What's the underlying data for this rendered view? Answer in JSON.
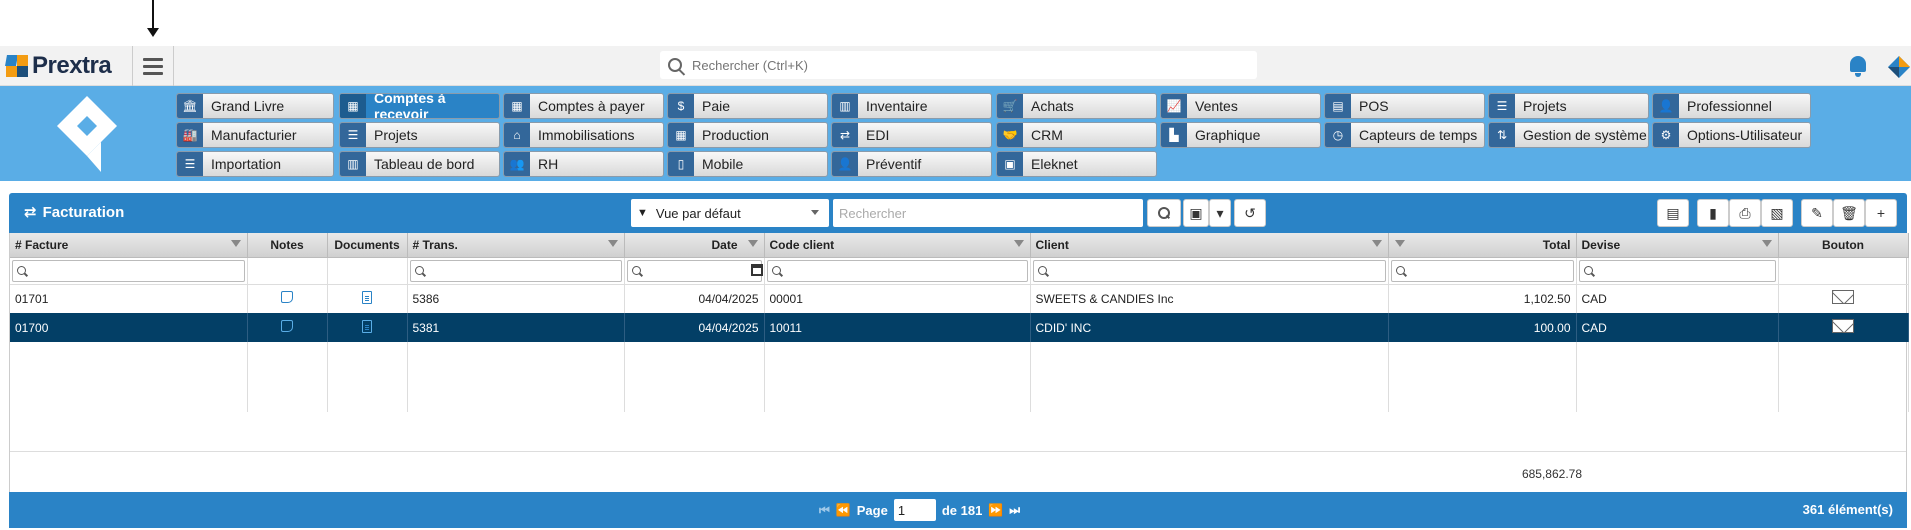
{
  "brand": {
    "name": "Prextra"
  },
  "global_search": {
    "placeholder": "Rechercher (Ctrl+K)"
  },
  "modules": [
    {
      "label": "Grand Livre",
      "icon": "bank-icon"
    },
    {
      "label": "Comptes à recevoir",
      "icon": "calculator-icon",
      "active": true
    },
    {
      "label": "Comptes à payer",
      "icon": "calculator-grid-icon"
    },
    {
      "label": "Paie",
      "icon": "dollar-icon"
    },
    {
      "label": "Inventaire",
      "icon": "warehouse-icon"
    },
    {
      "label": "Achats",
      "icon": "cart-icon"
    },
    {
      "label": "Ventes",
      "icon": "line-chart-icon"
    },
    {
      "label": "POS",
      "icon": "register-icon"
    },
    {
      "label": "Projets",
      "icon": "list-icon"
    },
    {
      "label": "Professionnel",
      "icon": "user-icon"
    },
    {
      "label": "Manufacturier",
      "icon": "factory-icon"
    },
    {
      "label": "Projets",
      "icon": "list-icon"
    },
    {
      "label": "Immobilisations",
      "icon": "home-icon"
    },
    {
      "label": "Production",
      "icon": "calendar-icon"
    },
    {
      "label": "EDI",
      "icon": "exchange-icon"
    },
    {
      "label": "CRM",
      "icon": "handshake-icon"
    },
    {
      "label": "Graphique",
      "icon": "chart-icon"
    },
    {
      "label": "Capteurs de temps",
      "icon": "clock-icon"
    },
    {
      "label": "Gestion de système",
      "icon": "system-icon"
    },
    {
      "label": "Options-Utilisateur",
      "icon": "user-gear-icon"
    },
    {
      "label": "Importation",
      "icon": "database-icon"
    },
    {
      "label": "Tableau de bord",
      "icon": "dashboard-icon"
    },
    {
      "label": "RH",
      "icon": "people-icon"
    },
    {
      "label": "Mobile",
      "icon": "mobile-icon"
    },
    {
      "label": "Préventif",
      "icon": "user-icon"
    },
    {
      "label": "Eleknet",
      "icon": "store-icon"
    }
  ],
  "panel": {
    "title": "Facturation",
    "view": "Vue par défaut",
    "search_placeholder": "Rechercher"
  },
  "grid": {
    "columns": [
      "# Facture",
      "Notes",
      "Documents",
      "# Trans.",
      "Date",
      "Code client",
      "Client",
      "Total",
      "Devise",
      "Bouton"
    ],
    "rows": [
      {
        "facture": "01701",
        "trans": "5386",
        "date": "04/04/2025",
        "code": "00001",
        "client": "SWEETS & CANDIES Inc",
        "total": "1,102.50",
        "devise": "CAD"
      },
      {
        "facture": "01700",
        "trans": "5381",
        "date": "04/04/2025",
        "code": "10011",
        "client": "CDID' INC",
        "total": "100.00",
        "devise": "CAD"
      }
    ],
    "grand_total": "685,862.78"
  },
  "footer": {
    "page_label": "Page",
    "page_value": "1",
    "of_label": "de 181",
    "items": "361 élément(s)"
  },
  "colors": {
    "accent": "#2a83c6",
    "selected_row": "#033f66",
    "module_bar": "#5aade6"
  }
}
